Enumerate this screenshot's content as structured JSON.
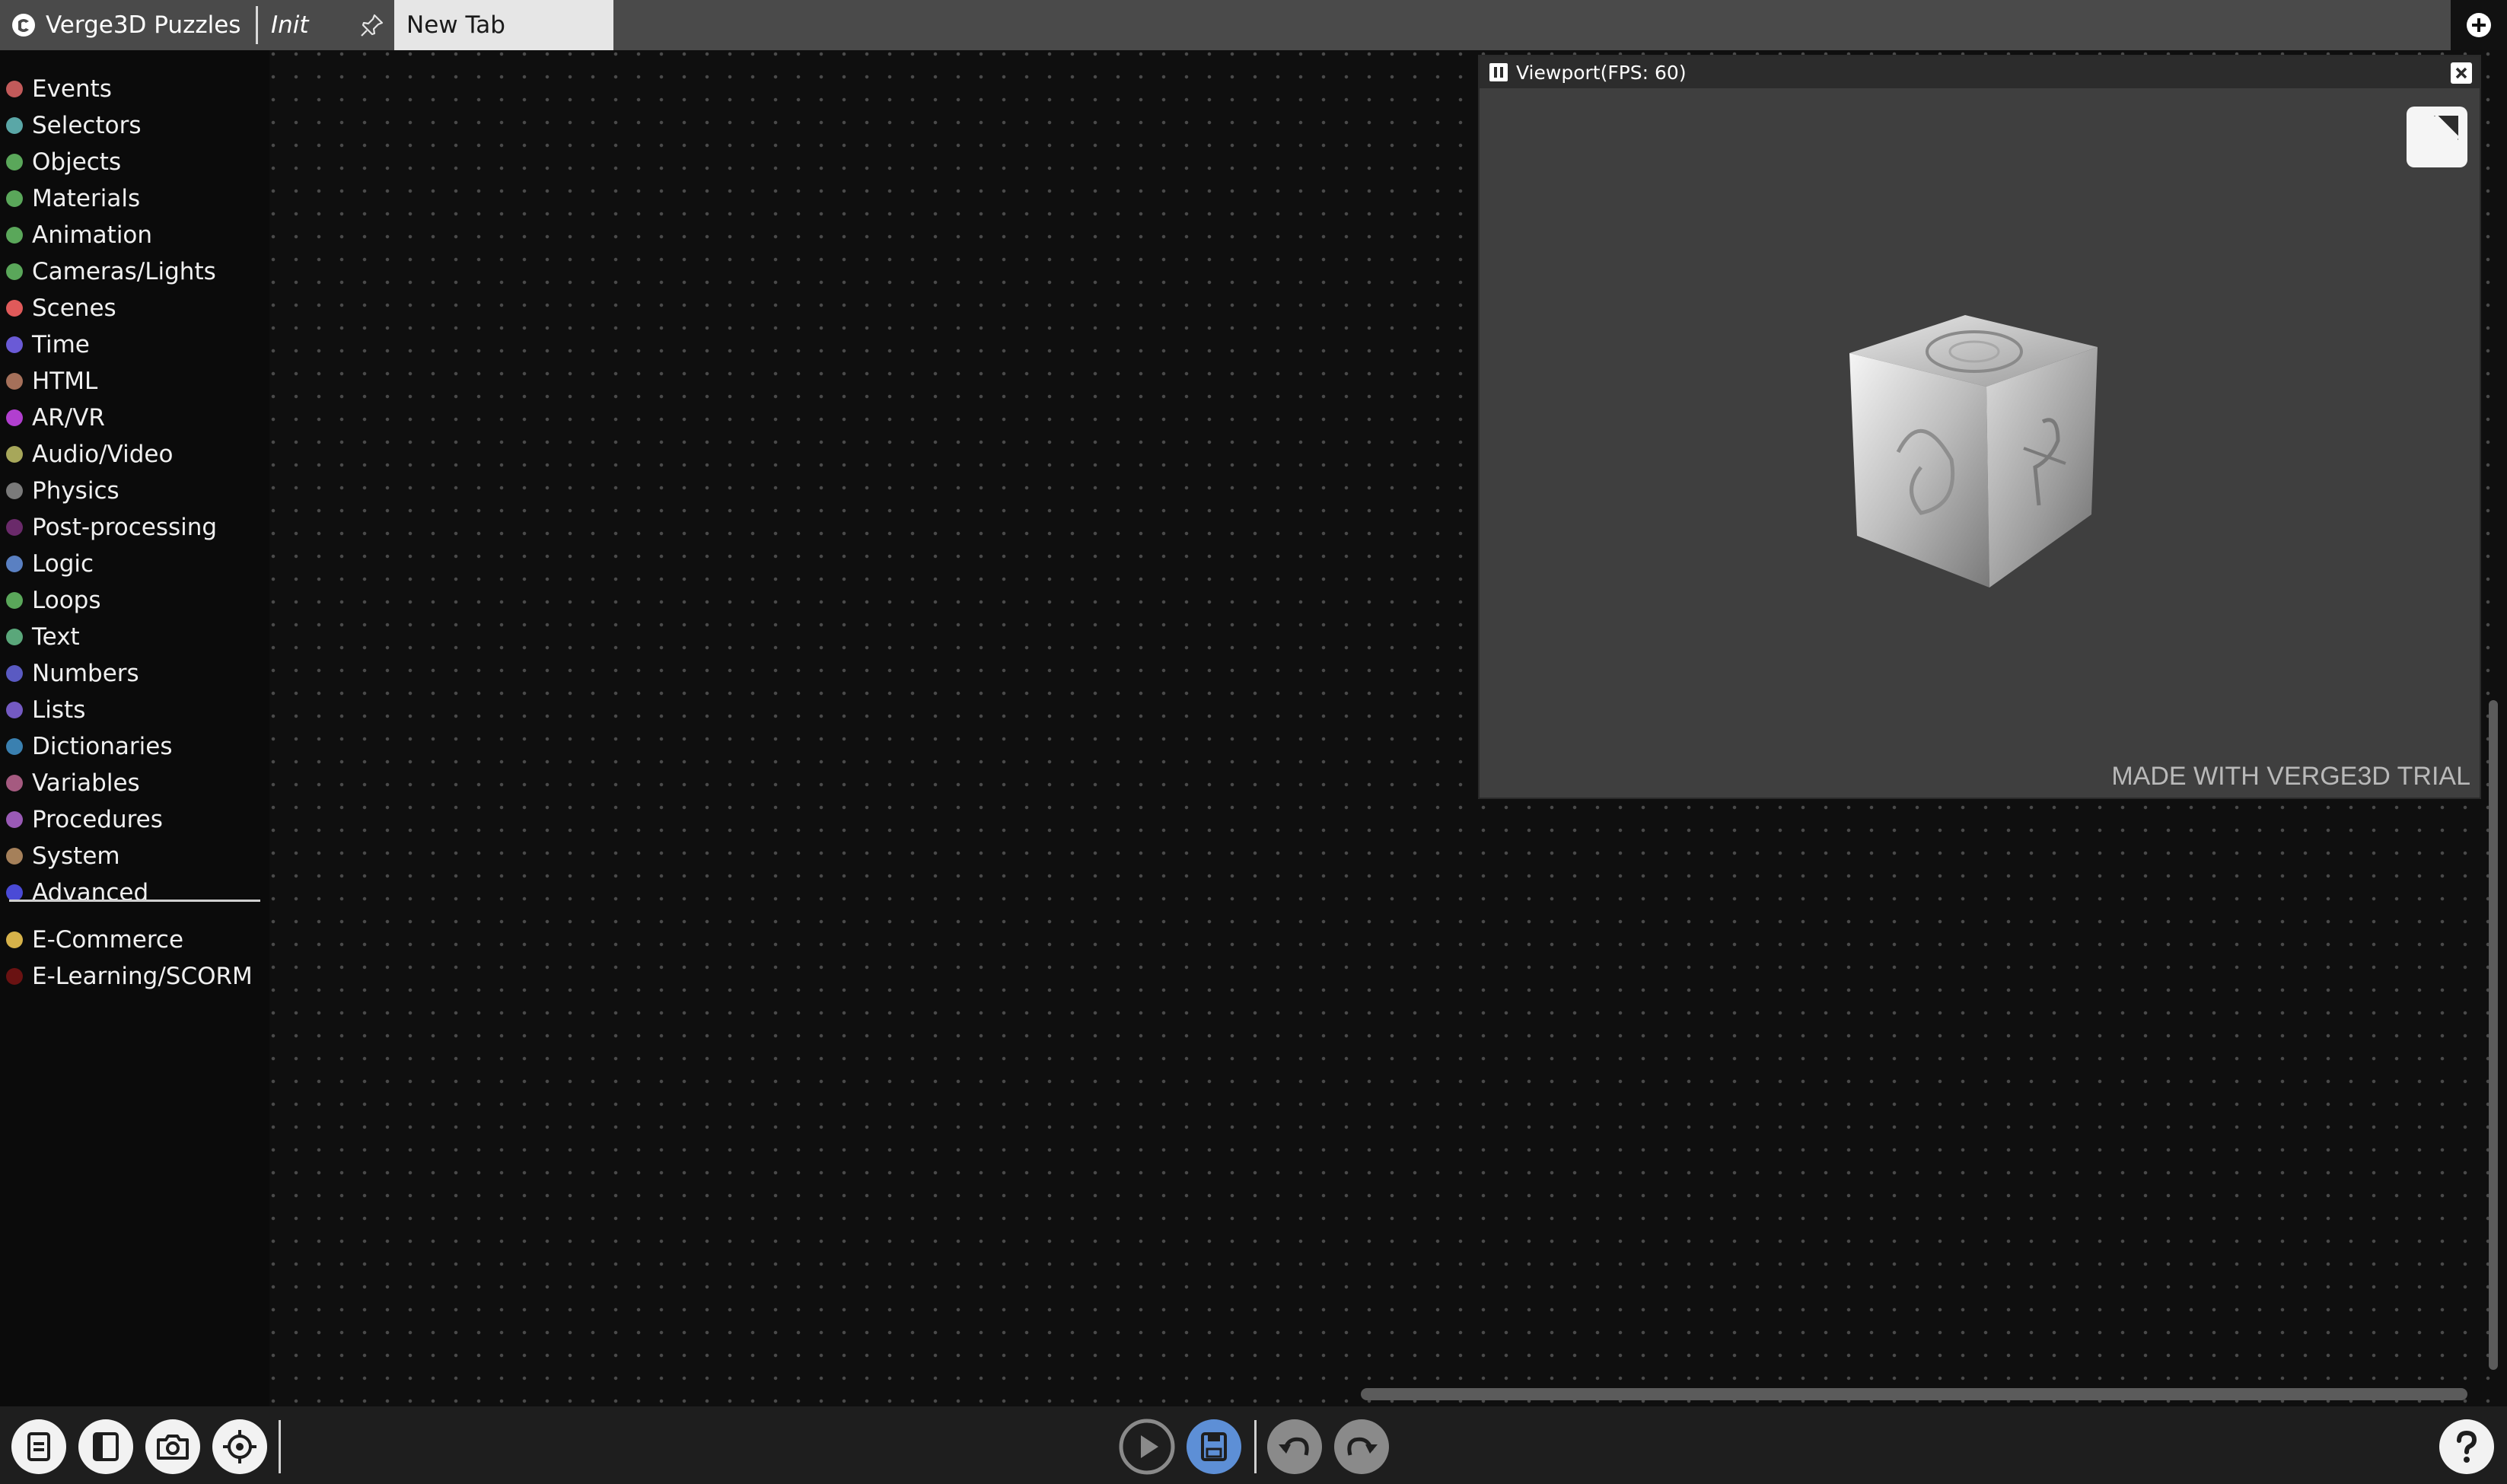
{
  "topbar": {
    "brand": "Verge3D Puzzles",
    "tabs": [
      {
        "label": "Init"
      },
      {
        "label": "New Tab"
      }
    ]
  },
  "sidebar": {
    "categories": [
      {
        "label": "Events",
        "color": "#c25a5a"
      },
      {
        "label": "Selectors",
        "color": "#5aa7a7"
      },
      {
        "label": "Objects",
        "color": "#5aa75a"
      },
      {
        "label": "Materials",
        "color": "#5aa75a"
      },
      {
        "label": "Animation",
        "color": "#5aa75a"
      },
      {
        "label": "Cameras/Lights",
        "color": "#5aa75a"
      },
      {
        "label": "Scenes",
        "color": "#e05a5a"
      },
      {
        "label": "Time",
        "color": "#6a5ad6"
      },
      {
        "label": "HTML",
        "color": "#a5705a"
      },
      {
        "label": "AR/VR",
        "color": "#b13fcf"
      },
      {
        "label": "Audio/Video",
        "color": "#a7a75a"
      },
      {
        "label": "Physics",
        "color": "#7a7a7a"
      },
      {
        "label": "Post-processing",
        "color": "#6a2a6a"
      },
      {
        "label": "Logic",
        "color": "#5a80c2"
      },
      {
        "label": "Loops",
        "color": "#5aa75a"
      },
      {
        "label": "Text",
        "color": "#5aa77a"
      },
      {
        "label": "Numbers",
        "color": "#5a5ac2"
      },
      {
        "label": "Lists",
        "color": "#745ac2"
      },
      {
        "label": "Dictionaries",
        "color": "#3a80b0"
      },
      {
        "label": "Variables",
        "color": "#a55a80"
      },
      {
        "label": "Procedures",
        "color": "#995ab5"
      },
      {
        "label": "System",
        "color": "#a5805a"
      },
      {
        "label": "Advanced",
        "color": "#4a4ad6"
      }
    ],
    "extras": [
      {
        "label": "E-Commerce",
        "color": "#d6b24a"
      },
      {
        "label": "E-Learning/SCORM",
        "color": "#6a1212"
      }
    ]
  },
  "viewport": {
    "title": "Viewport(FPS: 60)",
    "watermark": "MADE WITH VERGE3D TRIAL"
  },
  "toolbar": {
    "left_buttons": [
      "file-menu-icon",
      "sidebar-toggle-icon",
      "screenshot-camera-icon",
      "target-crosshair-icon"
    ],
    "center_buttons": [
      "play-icon",
      "save-icon",
      "undo-icon",
      "redo-icon"
    ],
    "help": "help-icon"
  },
  "colors": {
    "topbar": "#4a4a4a",
    "active_tab": "#e6e6e6",
    "workspace": "#0f0f0f",
    "save_accent": "#5d8fd6"
  }
}
